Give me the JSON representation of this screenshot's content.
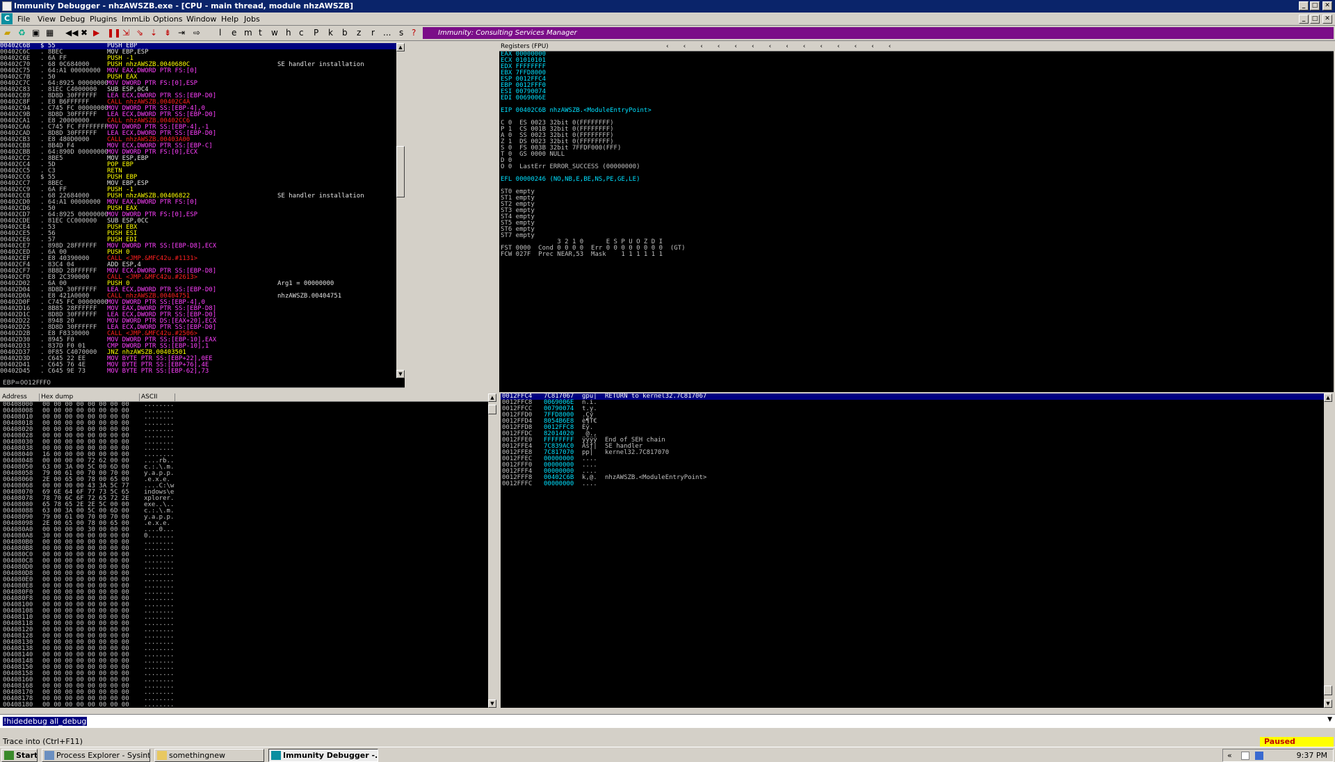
{
  "window": {
    "title": "Immunity Debugger - nhzAWSZB.exe - [CPU - main thread, module nhzAWSZB]",
    "min": "_",
    "max": "□",
    "close": "✕"
  },
  "menu": [
    "File",
    "View",
    "Debug",
    "Plugins",
    "ImmLib",
    "Options",
    "Window",
    "Help",
    "Jobs"
  ],
  "toolbar": {
    "letters": [
      "l",
      "e",
      "m",
      "t",
      "w",
      "h",
      "c",
      "P",
      "k",
      "b",
      "z",
      "r",
      "...",
      "s",
      "?"
    ]
  },
  "banner": "Immunity: Consulting Services Manager",
  "disasm": {
    "rows": [
      [
        "00402C6B",
        "$ 55",
        "PUSH EBP",
        ""
      ],
      [
        "00402C6C",
        ". 8BEC",
        "MOV EBP,ESP",
        ""
      ],
      [
        "00402C6E",
        ". 6A FF",
        "PUSH -1",
        ""
      ],
      [
        "00402C70",
        ". 68 0C684000",
        "PUSH nhzAWSZB.0040680C",
        "SE handler installation"
      ],
      [
        "00402C75",
        ". 64:A1 00000000",
        "MOV EAX,DWORD PTR FS:[0]",
        ""
      ],
      [
        "00402C7B",
        ". 50",
        "PUSH EAX",
        ""
      ],
      [
        "00402C7C",
        ". 64:8925 00000000",
        "MOV DWORD PTR FS:[0],ESP",
        ""
      ],
      [
        "00402C83",
        ". 81EC C4000000",
        "SUB ESP,0C4",
        ""
      ],
      [
        "00402C89",
        ". 8D8D 30FFFFFF",
        "LEA ECX,DWORD PTR SS:[EBP-D0]",
        ""
      ],
      [
        "00402C8F",
        ". E8 B6FFFFFF",
        "CALL nhzAWSZB.00402C4A",
        ""
      ],
      [
        "00402C94",
        ". C745 FC 00000000",
        "MOV DWORD PTR SS:[EBP-4],0",
        ""
      ],
      [
        "00402C9B",
        ". 8D8D 30FFFFFF",
        "LEA ECX,DWORD PTR SS:[EBP-D0]",
        ""
      ],
      [
        "00402CA1",
        ". E8 20000000",
        "CALL nhzAWSZB.00402CC6",
        ""
      ],
      [
        "00402CA6",
        ". C745 FC FFFFFFFF",
        "MOV DWORD PTR SS:[EBP-4],-1",
        ""
      ],
      [
        "00402CAD",
        ". 8D8D 30FFFFFF",
        "LEA ECX,DWORD PTR SS:[EBP-D0]",
        ""
      ],
      [
        "00402CB3",
        ". E8 480D0000",
        "CALL nhzAWSZB.00403A00",
        ""
      ],
      [
        "00402CB8",
        ". 8B4D F4",
        "MOV ECX,DWORD PTR SS:[EBP-C]",
        ""
      ],
      [
        "00402CBB",
        ". 64:890D 00000000",
        "MOV DWORD PTR FS:[0],ECX",
        ""
      ],
      [
        "00402CC2",
        ". 8BE5",
        "MOV ESP,EBP",
        ""
      ],
      [
        "00402CC4",
        ". 5D",
        "POP EBP",
        ""
      ],
      [
        "00402CC5",
        ". C3",
        "RETN",
        ""
      ],
      [
        "00402CC6",
        "$ 55",
        "PUSH EBP",
        ""
      ],
      [
        "00402CC7",
        ". 8BEC",
        "MOV EBP,ESP",
        ""
      ],
      [
        "00402CC9",
        ". 6A FF",
        "PUSH -1",
        ""
      ],
      [
        "00402CCB",
        ". 68 22684000",
        "PUSH nhzAWSZB.00406822",
        "SE handler installation"
      ],
      [
        "00402CD0",
        ". 64:A1 00000000",
        "MOV EAX,DWORD PTR FS:[0]",
        ""
      ],
      [
        "00402CD6",
        ". 50",
        "PUSH EAX",
        ""
      ],
      [
        "00402CD7",
        ". 64:8925 00000000",
        "MOV DWORD PTR FS:[0],ESP",
        ""
      ],
      [
        "00402CDE",
        ". 81EC CC000000",
        "SUB ESP,0CC",
        ""
      ],
      [
        "00402CE4",
        ". 53",
        "PUSH EBX",
        ""
      ],
      [
        "00402CE5",
        ". 56",
        "PUSH ESI",
        ""
      ],
      [
        "00402CE6",
        ". 57",
        "PUSH EDI",
        ""
      ],
      [
        "00402CE7",
        ". 898D 28FFFFFF",
        "MOV DWORD PTR SS:[EBP-D8],ECX",
        ""
      ],
      [
        "00402CED",
        ". 6A 00",
        "PUSH 0",
        ""
      ],
      [
        "00402CEF",
        ". E8 40390000",
        "CALL <JMP.&MFC42u.#1131>",
        ""
      ],
      [
        "00402CF4",
        ". 83C4 04",
        "ADD ESP,4",
        ""
      ],
      [
        "00402CF7",
        ". 8B8D 28FFFFFF",
        "MOV ECX,DWORD PTR SS:[EBP-D8]",
        ""
      ],
      [
        "00402CFD",
        ". E8 2C390000",
        "CALL <JMP.&MFC42u.#2613>",
        ""
      ],
      [
        "00402D02",
        ". 6A 00",
        "PUSH 0",
        "Arg1 = 00000000"
      ],
      [
        "00402D04",
        ". 8D8D 30FFFFFF",
        "LEA ECX,DWORD PTR SS:[EBP-D0]",
        ""
      ],
      [
        "00402D0A",
        ". E8 421A0000",
        "CALL nhzAWSZB.00404751",
        "nhzAWSZB.00404751"
      ],
      [
        "00402D0F",
        ". C745 FC 00000000",
        "MOV DWORD PTR SS:[EBP-4],0",
        ""
      ],
      [
        "00402D16",
        ". 8B85 28FFFFFF",
        "MOV EAX,DWORD PTR SS:[EBP-D8]",
        ""
      ],
      [
        "00402D1C",
        ". 8D8D 30FFFFFF",
        "LEA ECX,DWORD PTR SS:[EBP-D0]",
        ""
      ],
      [
        "00402D22",
        ". 8948 20",
        "MOV DWORD PTR DS:[EAX+20],ECX",
        ""
      ],
      [
        "00402D25",
        ". 8D8D 30FFFFFF",
        "LEA ECX,DWORD PTR SS:[EBP-D0]",
        ""
      ],
      [
        "00402D2B",
        ". E8 F8330000",
        "CALL <JMP.&MFC42u.#2506>",
        ""
      ],
      [
        "00402D30",
        ". 8945 F0",
        "MOV DWORD PTR SS:[EBP-10],EAX",
        ""
      ],
      [
        "00402D33",
        ". 837D F0 01",
        "CMP DWORD PTR SS:[EBP-10],1",
        ""
      ],
      [
        "00402D37",
        ". 0F85 C4070000",
        "JNZ nhzAWSZB.00403501",
        ""
      ],
      [
        "00402D3D",
        ". C645 22 EE",
        "MOV BYTE PTR SS:[EBP+22],0EE",
        ""
      ],
      [
        "00402D41",
        ". C645 76 4E",
        "MOV BYTE PTR SS:[EBP+76],4E",
        ""
      ],
      [
        "00402D45",
        ". C645 9E 73",
        "MOV BYTE PTR SS:[EBP-62],73",
        ""
      ]
    ],
    "info": "EBP=0012FFF0"
  },
  "registers": {
    "header": "Registers (FPU)",
    "lines": [
      "EAX 00000000",
      "ECX 01010101",
      "EDX FFFFFFFF",
      "EBX 7FFD8000",
      "ESP 0012FFC4",
      "EBP 0012FFF0",
      "ESI 00790074",
      "EDI 0069006E",
      "",
      "EIP 00402C6B nhzAWSZB.<ModuleEntryPoint>",
      "",
      "C 0  ES 0023 32bit 0(FFFFFFFF)",
      "P 1  CS 001B 32bit 0(FFFFFFFF)",
      "A 0  SS 0023 32bit 0(FFFFFFFF)",
      "Z 1  DS 0023 32bit 0(FFFFFFFF)",
      "S 0  FS 003B 32bit 7FFDF000(FFF)",
      "T 0  GS 0000 NULL",
      "D 0",
      "O 0  LastErr ERROR_SUCCESS (00000000)",
      "",
      "EFL 00000246 (NO,NB,E,BE,NS,PE,GE,LE)",
      "",
      "ST0 empty",
      "ST1 empty",
      "ST2 empty",
      "ST3 empty",
      "ST4 empty",
      "ST5 empty",
      "ST6 empty",
      "ST7 empty",
      "               3 2 1 0      E S P U O Z D I",
      "FST 0000  Cond 0 0 0 0  Err 0 0 0 0 0 0 0 0  (GT)",
      "FCW 027F  Prec NEAR,53  Mask    1 1 1 1 1 1"
    ]
  },
  "dump": {
    "headers": [
      "Address",
      "Hex dump",
      "ASCII"
    ],
    "rows": [
      [
        "00408000",
        "00 00 00 00 00 00 00 00",
        "........"
      ],
      [
        "00408008",
        "00 00 00 00 00 00 00 00",
        "........"
      ],
      [
        "00408010",
        "00 00 00 00 00 00 00 00",
        "........"
      ],
      [
        "00408018",
        "00 00 00 00 00 00 00 00",
        "........"
      ],
      [
        "00408020",
        "00 00 00 00 00 00 00 00",
        "........"
      ],
      [
        "00408028",
        "00 00 00 00 00 00 00 00",
        "........"
      ],
      [
        "00408030",
        "00 00 00 00 00 00 00 00",
        "........"
      ],
      [
        "00408038",
        "00 00 00 00 00 00 00 00",
        "........"
      ],
      [
        "00408040",
        "16 00 00 00 00 00 00 00",
        "........"
      ],
      [
        "00408048",
        "00 00 00 00 72 62 00 00",
        "....rb.."
      ],
      [
        "00408050",
        "63 00 3A 00 5C 00 6D 00",
        "c.:.\\.m."
      ],
      [
        "00408058",
        "79 00 61 00 70 00 70 00",
        "y.a.p.p."
      ],
      [
        "00408060",
        "2E 00 65 00 78 00 65 00",
        ".e.x.e."
      ],
      [
        "00408068",
        "00 00 00 00 43 3A 5C 77",
        "....C:\\w"
      ],
      [
        "00408070",
        "69 6E 64 6F 77 73 5C 65",
        "indows\\e"
      ],
      [
        "00408078",
        "78 70 6C 6F 72 65 72 2E",
        "xplorer."
      ],
      [
        "00408080",
        "65 78 65 2E 2E 5C 00 00",
        "exe..\\.."
      ],
      [
        "00408088",
        "63 00 3A 00 5C 00 6D 00",
        "c.:.\\.m."
      ],
      [
        "00408090",
        "79 00 61 00 70 00 70 00",
        "y.a.p.p."
      ],
      [
        "00408098",
        "2E 00 65 00 78 00 65 00",
        ".e.x.e."
      ],
      [
        "004080A0",
        "00 00 00 00 30 00 00 00",
        "....0..."
      ],
      [
        "004080A8",
        "30 00 00 00 00 00 00 00",
        "0......."
      ],
      [
        "004080B0",
        "00 00 00 00 00 00 00 00",
        "........"
      ],
      [
        "004080B8",
        "00 00 00 00 00 00 00 00",
        "........"
      ],
      [
        "004080C0",
        "00 00 00 00 00 00 00 00",
        "........"
      ],
      [
        "004080C8",
        "00 00 00 00 00 00 00 00",
        "........"
      ],
      [
        "004080D0",
        "00 00 00 00 00 00 00 00",
        "........"
      ],
      [
        "004080D8",
        "00 00 00 00 00 00 00 00",
        "........"
      ],
      [
        "004080E0",
        "00 00 00 00 00 00 00 00",
        "........"
      ],
      [
        "004080E8",
        "00 00 00 00 00 00 00 00",
        "........"
      ],
      [
        "004080F0",
        "00 00 00 00 00 00 00 00",
        "........"
      ],
      [
        "004080F8",
        "00 00 00 00 00 00 00 00",
        "........"
      ],
      [
        "00408100",
        "00 00 00 00 00 00 00 00",
        "........"
      ],
      [
        "00408108",
        "00 00 00 00 00 00 00 00",
        "........"
      ],
      [
        "00408110",
        "00 00 00 00 00 00 00 00",
        "........"
      ],
      [
        "00408118",
        "00 00 00 00 00 00 00 00",
        "........"
      ],
      [
        "00408120",
        "00 00 00 00 00 00 00 00",
        "........"
      ],
      [
        "00408128",
        "00 00 00 00 00 00 00 00",
        "........"
      ],
      [
        "00408130",
        "00 00 00 00 00 00 00 00",
        "........"
      ],
      [
        "00408138",
        "00 00 00 00 00 00 00 00",
        "........"
      ],
      [
        "00408140",
        "00 00 00 00 00 00 00 00",
        "........"
      ],
      [
        "00408148",
        "00 00 00 00 00 00 00 00",
        "........"
      ],
      [
        "00408150",
        "00 00 00 00 00 00 00 00",
        "........"
      ],
      [
        "00408158",
        "00 00 00 00 00 00 00 00",
        "........"
      ],
      [
        "00408160",
        "00 00 00 00 00 00 00 00",
        "........"
      ],
      [
        "00408168",
        "00 00 00 00 00 00 00 00",
        "........"
      ],
      [
        "00408170",
        "00 00 00 00 00 00 00 00",
        "........"
      ],
      [
        "00408178",
        "00 00 00 00 00 00 00 00",
        "........"
      ],
      [
        "00408180",
        "00 00 00 00 00 00 00 00",
        "........"
      ]
    ]
  },
  "stack": {
    "rows": [
      [
        "0012FFC4",
        "7C817067",
        "gpü|",
        "RETURN to kernel32.7C817067"
      ],
      [
        "0012FFC8",
        "0069006E",
        "n.i.",
        ""
      ],
      [
        "0012FFCC",
        "00790074",
        "t.y.",
        ""
      ],
      [
        "0012FFD0",
        "7FFD8000",
        ".Çý",
        ""
      ],
      [
        "0012FFD4",
        "8054B6E8",
        "è¶T€",
        ""
      ],
      [
        "0012FFD8",
        "0012FFC8",
        "Èÿ.",
        ""
      ],
      [
        "0012FFDC",
        "82014020",
        " @.‚",
        ""
      ],
      [
        "0012FFE0",
        "FFFFFFFF",
        "ÿÿÿÿ",
        "End of SEH chain"
      ],
      [
        "0012FFE4",
        "7C839AC0",
        "Àšƒ|",
        "SE handler"
      ],
      [
        "0012FFE8",
        "7C817070",
        "pp|",
        "kernel32.7C817070"
      ],
      [
        "0012FFEC",
        "00000000",
        "....",
        ""
      ],
      [
        "0012FFF0",
        "00000000",
        "....",
        ""
      ],
      [
        "0012FFF4",
        "00000000",
        "....",
        ""
      ],
      [
        "0012FFF8",
        "00402C6B",
        "k,@.",
        "nhzAWSZB.<ModuleEntryPoint>"
      ],
      [
        "0012FFFC",
        "00000000",
        "....",
        ""
      ]
    ]
  },
  "command": "!hidedebug all_debug",
  "status": {
    "text": "Trace into (Ctrl+F11)",
    "state": "Paused"
  },
  "taskbar": {
    "start": "Start",
    "items": [
      "Process Explorer - Sysint...",
      "somethingnew",
      "Immunity Debugger -..."
    ],
    "clock": "9:37 PM"
  },
  "colors": {
    "banner": "#7b0d88",
    "selection": "#000080",
    "paused_bg": "#ffff00"
  }
}
